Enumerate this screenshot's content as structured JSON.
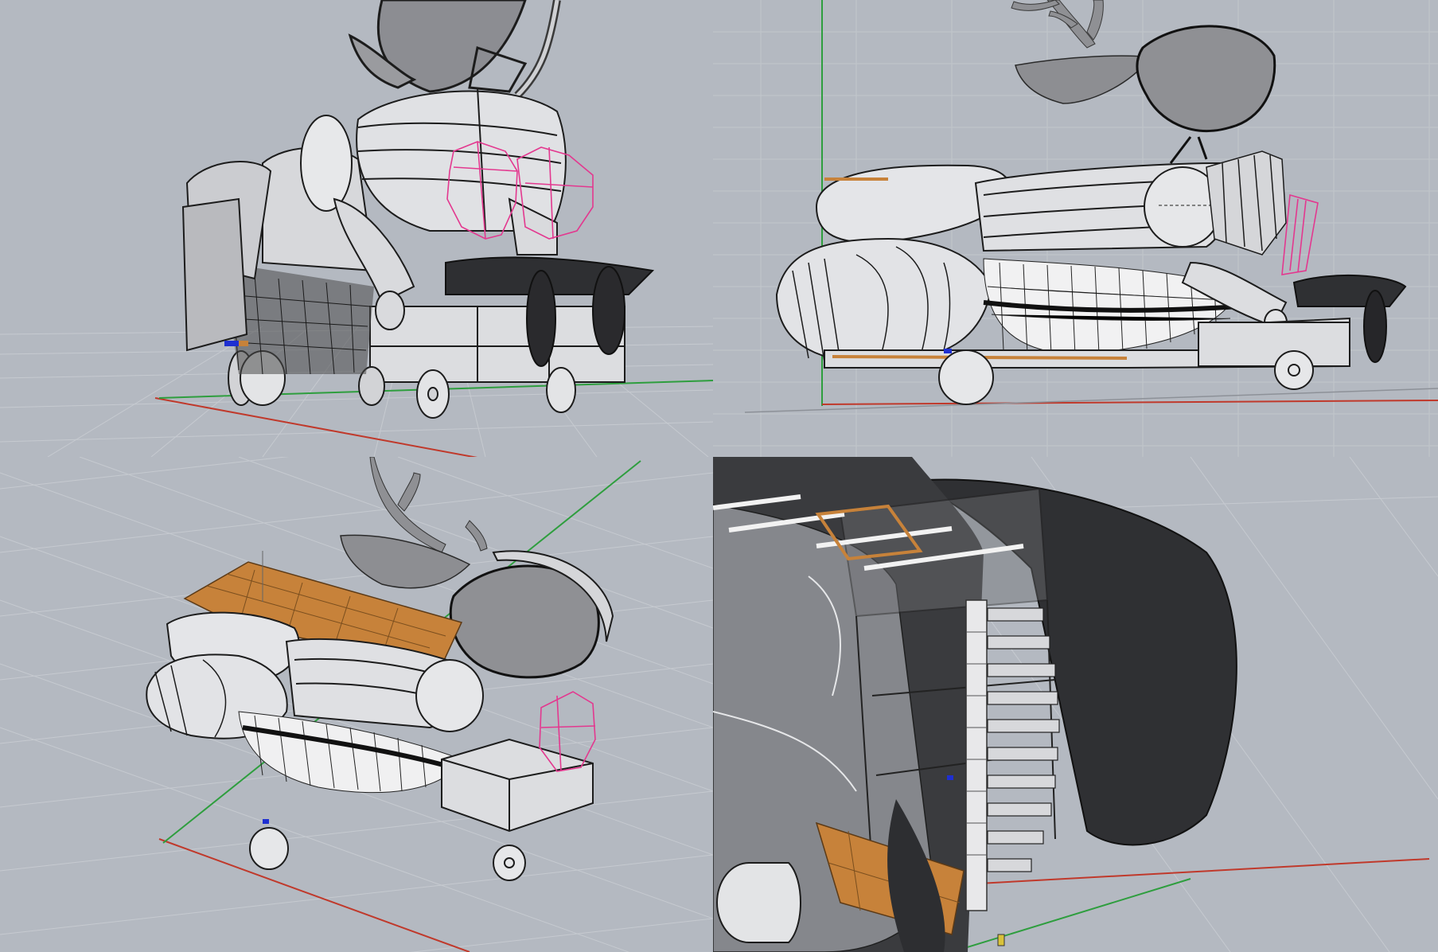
{
  "viewports": [
    {
      "id": "perspective-front",
      "projection": "perspective"
    },
    {
      "id": "side",
      "projection": "parallel"
    },
    {
      "id": "perspective-iso",
      "projection": "perspective"
    },
    {
      "id": "cutaway-rear",
      "projection": "perspective"
    }
  ],
  "colors": {
    "background": "#b4b9c1",
    "grid": "#c5c9cf",
    "x_axis": "#c0392b",
    "y_axis": "#2e9e3e",
    "body_surface": "#e2e3e6",
    "body_edge": "#1c1c1c",
    "selection": "#e3388f",
    "platform": "#c7823a",
    "gumball": "#1e2fd1"
  },
  "icons": [
    "z-axis-widget-icon",
    "gumball-icon"
  ]
}
